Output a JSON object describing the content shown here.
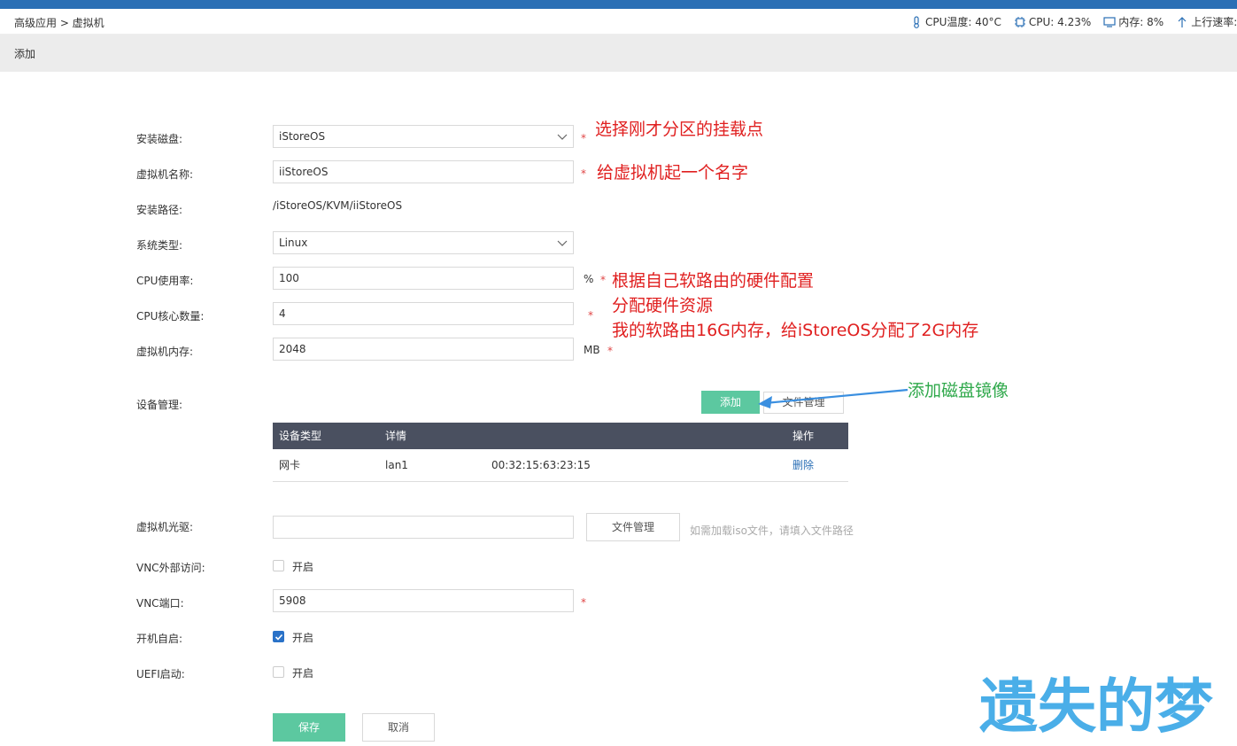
{
  "header": {
    "breadcrumb": "高级应用 > 虚拟机",
    "stats": {
      "cpu_temp": "CPU温度: 40°C",
      "cpu": "CPU: 4.23%",
      "memory": "内存: 8%",
      "upload": "上行速率:"
    }
  },
  "page": {
    "title": "添加"
  },
  "form": {
    "install_disk": {
      "label": "安装磁盘:",
      "value": "iStoreOS"
    },
    "vm_name": {
      "label": "虚拟机名称:",
      "value": "iiStoreOS"
    },
    "install_path": {
      "label": "安装路径:",
      "value": "/iStoreOS/KVM/iiStoreOS"
    },
    "os_type": {
      "label": "系统类型:",
      "value": "Linux"
    },
    "cpu_usage": {
      "label": "CPU使用率:",
      "value": "100",
      "unit": "%"
    },
    "cpu_cores": {
      "label": "CPU核心数量:",
      "value": "4"
    },
    "vm_memory": {
      "label": "虚拟机内存:",
      "value": "2048",
      "unit": "MB"
    },
    "device_mgmt": {
      "label": "设备管理:",
      "add_label": "添加",
      "file_mgmt_label": "文件管理",
      "columns": [
        "设备类型",
        "详情",
        "操作"
      ],
      "rows": [
        {
          "type": "网卡",
          "detail": "lan1",
          "mac": "00:32:15:63:23:15",
          "action": "删除"
        }
      ]
    },
    "cdrom": {
      "label": "虚拟机光驱:",
      "value": "",
      "file_mgmt_label": "文件管理",
      "hint": "如需加载iso文件，请填入文件路径"
    },
    "vnc_external": {
      "label": "VNC外部访问:",
      "option": "开启",
      "checked": false
    },
    "vnc_port": {
      "label": "VNC端口:",
      "value": "5908"
    },
    "autostart": {
      "label": "开机自启:",
      "option": "开启",
      "checked": true
    },
    "uefi": {
      "label": "UEFI启动:",
      "option": "开启",
      "checked": false
    },
    "save_label": "保存",
    "cancel_label": "取消"
  },
  "annotations": {
    "disk_note": "选择刚才分区的挂载点",
    "name_note": "给虚拟机起一个名字",
    "resource_note_1": "根据自己软路由的硬件配置",
    "resource_note_2": "分配硬件资源",
    "resource_note_3": "我的软路由16G内存，给iStoreOS分配了2G内存",
    "add_note": "添加磁盘镜像"
  },
  "watermark": "遗失的梦",
  "colors": {
    "accent": "#2a6fb5",
    "green_button": "#5cc8a0",
    "table_header": "#4a5060",
    "note_red": "#e02020",
    "note_green": "#2ea84a",
    "watermark": "#4aaee8"
  },
  "icons": [
    "thermometer-icon",
    "cpu-chip-icon",
    "monitor-icon",
    "arrow-up-icon",
    "chevron-down-icon",
    "check-icon"
  ]
}
